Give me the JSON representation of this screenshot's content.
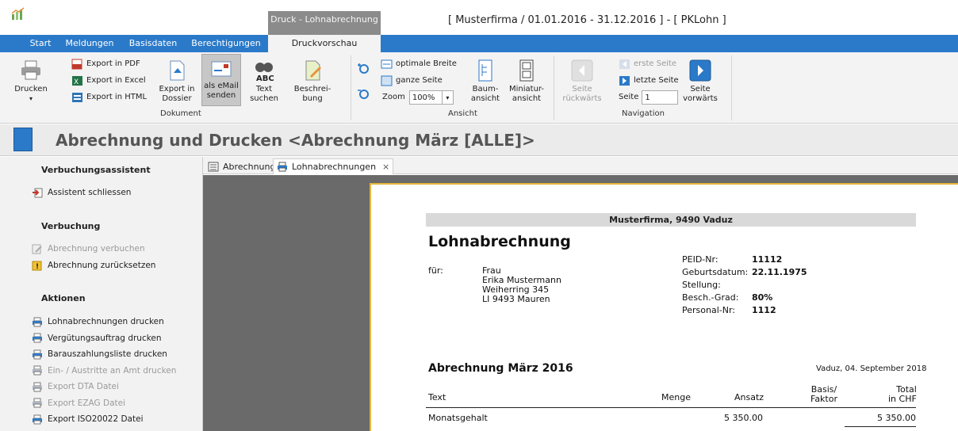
{
  "window": {
    "context_tab": "Druck - Lohnabrechnung",
    "title": "[ Musterfirma / 01.01.2016 - 31.12.2016 ] - [ PKLohn ]"
  },
  "tabs": [
    "Start",
    "Meldungen",
    "Basisdaten",
    "Berechtigungen",
    "Druckvorschau"
  ],
  "ribbon": {
    "drucken": "Drucken",
    "export_pdf": "Export in PDF",
    "export_excel": "Export in Excel",
    "export_html": "Export in HTML",
    "export_dossier": "Export in\nDossier",
    "email": "als eMail\nsenden",
    "text_suchen": "Text\nsuchen",
    "beschreibung": "Beschrei-\nbung",
    "group_dokument": "Dokument",
    "optimale_breite": "optimale Breite",
    "ganze_seite": "ganze Seite",
    "zoom_label": "Zoom",
    "zoom_value": "100%",
    "baumansicht": "Baum-\nansicht",
    "miniaturansicht": "Miniatur-\nansicht",
    "group_ansicht": "Ansicht",
    "seite_rueckwaerts": "Seite\nrückwärts",
    "erste_seite": "erste Seite",
    "letzte_seite": "letzte Seite",
    "seite_label": "Seite",
    "seite_value": "1",
    "seite_vorwaerts": "Seite\nvorwärts",
    "group_navigation": "Navigation"
  },
  "header": {
    "title": "Abrechnung und Drucken <Abrechnung März [ALLE]>"
  },
  "sidebar": {
    "h_assistent": "Verbuchungsassistent",
    "assistent_schliessen": "Assistent schliessen",
    "h_verbuchung": "Verbuchung",
    "abrechnung_verbuchen": "Abrechnung verbuchen",
    "abrechnung_zuruecksetzen": "Abrechnung zurücksetzen",
    "h_aktionen": "Aktionen",
    "items": [
      {
        "label": "Lohnabrechnungen drucken",
        "enabled": true
      },
      {
        "label": "Vergütungsauftrag drucken",
        "enabled": true
      },
      {
        "label": "Barauszahlungsliste drucken",
        "enabled": true
      },
      {
        "label": "Ein- / Austritte an Amt drucken",
        "enabled": false
      },
      {
        "label": "Export DTA Datei",
        "enabled": false
      },
      {
        "label": "Export EZAG Datei",
        "enabled": false
      },
      {
        "label": "Export ISO20022 Datei",
        "enabled": true
      }
    ]
  },
  "doc_tabs": [
    "Abrechnung",
    "Lohnabrechnungen"
  ],
  "document": {
    "firm": "Musterfirma, 9490 Vaduz",
    "title": "Lohnabrechnung",
    "fuer_label": "für:",
    "address": [
      "Frau",
      "Erika Mustermann",
      "Weiherring 345",
      "LI 9493 Mauren"
    ],
    "info_labels": [
      "PEID-Nr:",
      "Geburtsdatum:",
      "Stellung:",
      "Besch.-Grad:",
      "Personal-Nr:"
    ],
    "info_values": [
      "11112",
      "22.11.1975",
      "",
      "80%",
      "1112"
    ],
    "period_title": "Abrechnung März 2016",
    "date_line": "Vaduz, 04. September 2018",
    "col_text": "Text",
    "col_menge": "Menge",
    "col_ansatz": "Ansatz",
    "col_basis": "Basis/\nFaktor",
    "col_total": "Total\nin CHF",
    "row1_text": "Monatsgehalt",
    "row1_ansatz": "5 350.00",
    "row1_total": "5 350.00"
  }
}
